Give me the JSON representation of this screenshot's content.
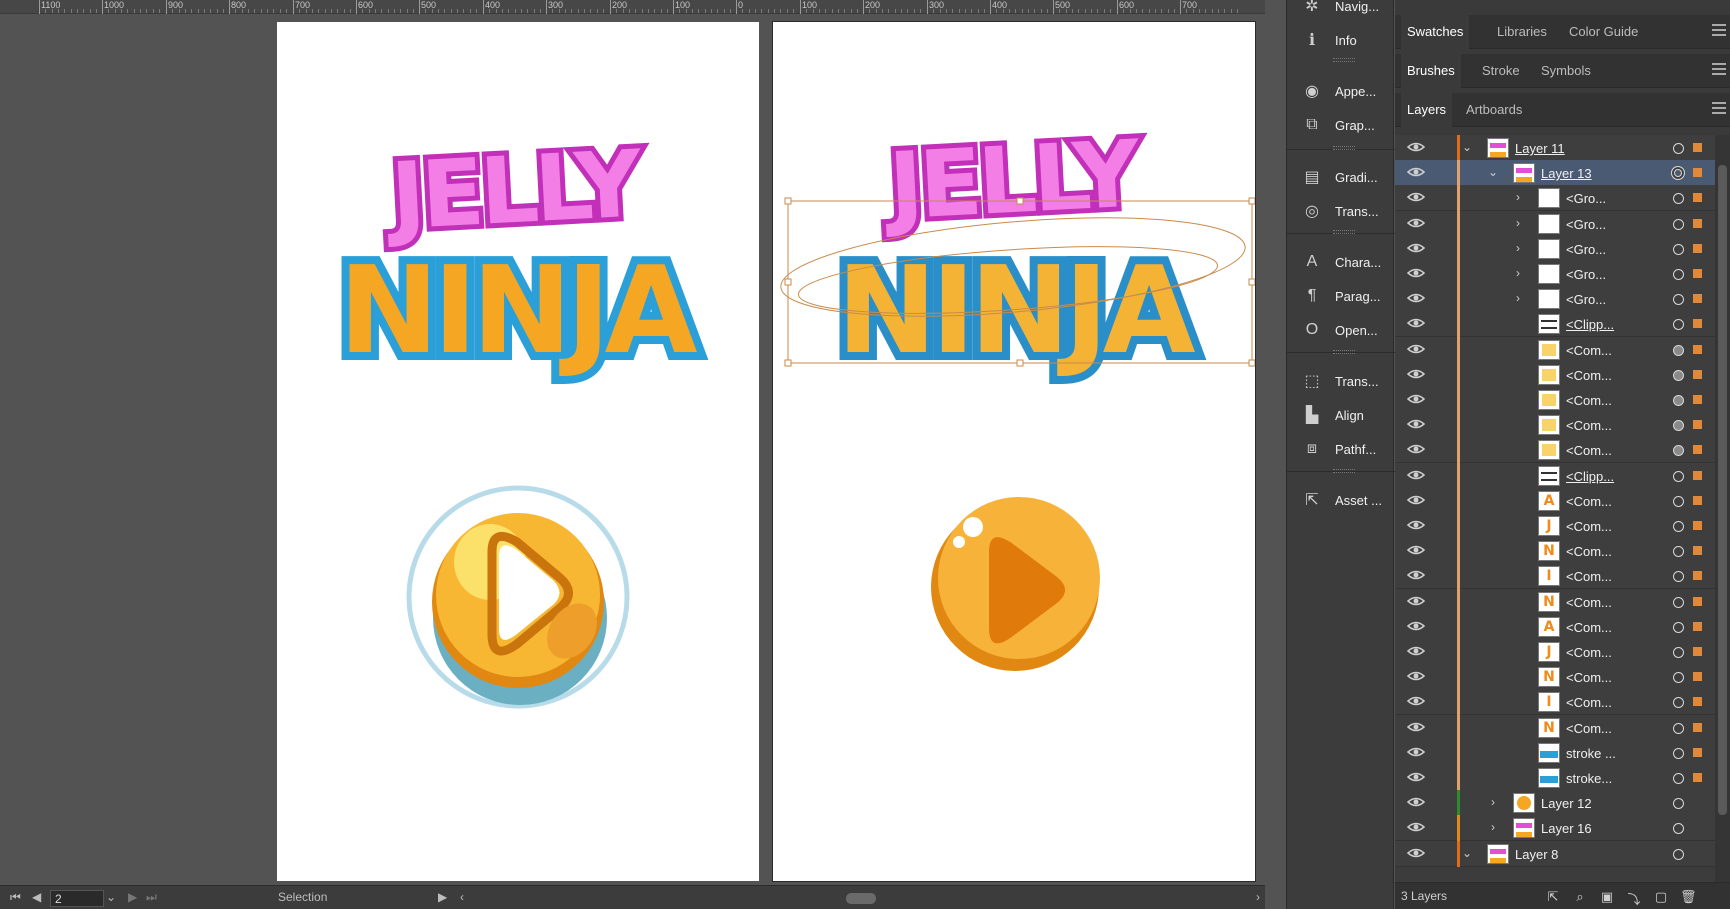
{
  "ruler": {
    "labels": [
      "1100",
      "1000",
      "900",
      "800",
      "700",
      "600",
      "500",
      "400",
      "300",
      "200",
      "100",
      "0",
      "100",
      "200",
      "300",
      "400",
      "500",
      "600",
      "700"
    ]
  },
  "status_bar": {
    "page_value": "2",
    "tool_label": "Selection"
  },
  "tool_panels": [
    {
      "label": "Navig...",
      "icon": "navigator-icon"
    },
    {
      "label": "Info",
      "icon": "info-icon"
    },
    {
      "label": "Appe...",
      "icon": "appearance-icon"
    },
    {
      "label": "Grap...",
      "icon": "graphic-styles-icon"
    },
    {
      "label": "Gradi...",
      "icon": "gradient-icon"
    },
    {
      "label": "Trans...",
      "icon": "transparency-icon"
    },
    {
      "label": "Chara...",
      "icon": "character-icon"
    },
    {
      "label": "Parag...",
      "icon": "paragraph-icon"
    },
    {
      "label": "Open...",
      "icon": "opentype-icon"
    },
    {
      "label": "Trans...",
      "icon": "transform-icon"
    },
    {
      "label": "Align",
      "icon": "align-icon"
    },
    {
      "label": "Pathf...",
      "icon": "pathfinder-icon"
    },
    {
      "label": "Asset ...",
      "icon": "asset-export-icon"
    }
  ],
  "tab_groups": [
    {
      "tabs": [
        "Swatches",
        "Libraries",
        "Color Guide"
      ],
      "active": 0
    },
    {
      "tabs": [
        "Brushes",
        "Stroke",
        "Symbols"
      ],
      "active": 0
    },
    {
      "tabs": [
        "Layers",
        "Artboards"
      ],
      "active": 0
    }
  ],
  "layers": [
    {
      "name": "Layer 11",
      "level": 0,
      "expand": "open",
      "color": "#e06a1e",
      "selected": false,
      "underline": true,
      "thumb": "logo",
      "target": "ring",
      "sel": "on"
    },
    {
      "name": "Layer 13",
      "level": 1,
      "expand": "open",
      "color": "#e0a070",
      "selected": true,
      "underline": true,
      "thumb": "logo",
      "target": "double",
      "sel": "on"
    },
    {
      "name": "<Gro...",
      "level": 2,
      "expand": "closed",
      "color": "#e0a070",
      "selected": false,
      "underline": false,
      "thumb": "blank",
      "target": "ring",
      "sel": "on"
    },
    {
      "name": "<Gro...",
      "level": 2,
      "expand": "closed",
      "color": "#e0a070",
      "selected": false,
      "underline": false,
      "thumb": "blank",
      "target": "ring",
      "sel": "on"
    },
    {
      "name": "<Gro...",
      "level": 2,
      "expand": "closed",
      "color": "#e0a070",
      "selected": false,
      "underline": false,
      "thumb": "blank",
      "target": "ring",
      "sel": "on"
    },
    {
      "name": "<Gro...",
      "level": 2,
      "expand": "closed",
      "color": "#e0a070",
      "selected": false,
      "underline": false,
      "thumb": "blank",
      "target": "ring",
      "sel": "on"
    },
    {
      "name": "<Gro...",
      "level": 2,
      "expand": "closed",
      "color": "#e0a070",
      "selected": false,
      "underline": false,
      "thumb": "blank",
      "target": "ring",
      "sel": "on"
    },
    {
      "name": "<Clipp...",
      "level": 2,
      "expand": "none",
      "color": "#e0a070",
      "selected": false,
      "underline": true,
      "thumb": "clip",
      "target": "ring",
      "sel": "on"
    },
    {
      "name": "<Com...",
      "level": 2,
      "expand": "none",
      "color": "#e0a070",
      "selected": false,
      "underline": false,
      "thumb": "yellow",
      "target": "filled",
      "sel": "on"
    },
    {
      "name": "<Com...",
      "level": 2,
      "expand": "none",
      "color": "#e0a070",
      "selected": false,
      "underline": false,
      "thumb": "yellow",
      "target": "filled",
      "sel": "on"
    },
    {
      "name": "<Com...",
      "level": 2,
      "expand": "none",
      "color": "#e0a070",
      "selected": false,
      "underline": false,
      "thumb": "yellow",
      "target": "filled",
      "sel": "on"
    },
    {
      "name": "<Com...",
      "level": 2,
      "expand": "none",
      "color": "#e0a070",
      "selected": false,
      "underline": false,
      "thumb": "yellow",
      "target": "filled",
      "sel": "on"
    },
    {
      "name": "<Com...",
      "level": 2,
      "expand": "none",
      "color": "#e0a070",
      "selected": false,
      "underline": false,
      "thumb": "yellow",
      "target": "filled",
      "sel": "on"
    },
    {
      "name": "<Clipp...",
      "level": 2,
      "expand": "none",
      "color": "#e0a070",
      "selected": false,
      "underline": true,
      "thumb": "clip",
      "target": "ring",
      "sel": "on"
    },
    {
      "name": "<Com...",
      "level": 2,
      "expand": "none",
      "color": "#e0a070",
      "selected": false,
      "underline": false,
      "thumb": "A",
      "target": "ring",
      "sel": "on"
    },
    {
      "name": "<Com...",
      "level": 2,
      "expand": "none",
      "color": "#e0a070",
      "selected": false,
      "underline": false,
      "thumb": "J",
      "target": "ring",
      "sel": "on"
    },
    {
      "name": "<Com...",
      "level": 2,
      "expand": "none",
      "color": "#e0a070",
      "selected": false,
      "underline": false,
      "thumb": "N",
      "target": "ring",
      "sel": "on"
    },
    {
      "name": "<Com...",
      "level": 2,
      "expand": "none",
      "color": "#e0a070",
      "selected": false,
      "underline": false,
      "thumb": "I",
      "target": "ring",
      "sel": "on"
    },
    {
      "name": "<Com...",
      "level": 2,
      "expand": "none",
      "color": "#e0a070",
      "selected": false,
      "underline": false,
      "thumb": "N",
      "target": "ring",
      "sel": "on"
    },
    {
      "name": "<Com...",
      "level": 2,
      "expand": "none",
      "color": "#e0a070",
      "selected": false,
      "underline": false,
      "thumb": "A",
      "target": "ring",
      "sel": "on"
    },
    {
      "name": "<Com...",
      "level": 2,
      "expand": "none",
      "color": "#e0a070",
      "selected": false,
      "underline": false,
      "thumb": "J",
      "target": "ring",
      "sel": "on"
    },
    {
      "name": "<Com...",
      "level": 2,
      "expand": "none",
      "color": "#e0a070",
      "selected": false,
      "underline": false,
      "thumb": "N",
      "target": "ring",
      "sel": "on"
    },
    {
      "name": "<Com...",
      "level": 2,
      "expand": "none",
      "color": "#e0a070",
      "selected": false,
      "underline": false,
      "thumb": "I",
      "target": "ring",
      "sel": "on"
    },
    {
      "name": "<Com...",
      "level": 2,
      "expand": "none",
      "color": "#e0a070",
      "selected": false,
      "underline": false,
      "thumb": "N",
      "target": "ring",
      "sel": "on"
    },
    {
      "name": "stroke ...",
      "level": 2,
      "expand": "none",
      "color": "#e0a070",
      "selected": false,
      "underline": false,
      "thumb": "stroke",
      "target": "ring",
      "sel": "on"
    },
    {
      "name": "stroke...",
      "level": 2,
      "expand": "none",
      "color": "#e0a070",
      "selected": false,
      "underline": false,
      "thumb": "stroke",
      "target": "ring",
      "sel": "on"
    },
    {
      "name": "Layer 12",
      "level": 1,
      "expand": "closed",
      "color": "#2e8b2e",
      "selected": false,
      "underline": false,
      "thumb": "button",
      "target": "ring",
      "sel": "off"
    },
    {
      "name": "Layer 16",
      "level": 1,
      "expand": "closed",
      "color": "#e08a1e",
      "selected": false,
      "underline": false,
      "thumb": "logo",
      "target": "ring",
      "sel": "off"
    },
    {
      "name": "Layer 8",
      "level": 0,
      "expand": "open",
      "color": "#e06a1e",
      "selected": false,
      "underline": false,
      "thumb": "logo",
      "target": "ring",
      "sel": "off"
    }
  ],
  "layers_footer": {
    "count": "3 Layers"
  },
  "artwork": {
    "logo_line1": "JELLY",
    "logo_line2": "NINJA"
  },
  "colors": {
    "selection": "#e0893a",
    "jelly_pink": "#e24fd6",
    "ninja_orange": "#f5a623",
    "ninja_blue": "#2a9fd8",
    "button_orange": "#f7b733"
  }
}
